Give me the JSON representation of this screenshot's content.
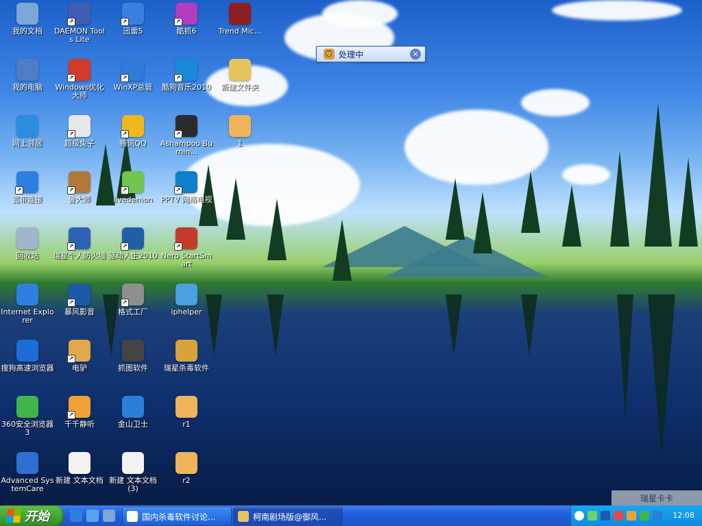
{
  "desktop": {
    "icons": [
      {
        "label": "我的文档",
        "color": "#7aa6d9"
      },
      {
        "label": "DAEMON Tools Lite",
        "color": "#3f5db0"
      },
      {
        "label": "迅雷5",
        "color": "#3a7fe0"
      },
      {
        "label": "酷抓6",
        "color": "#b33cc0"
      },
      {
        "label": "Trend Mic...",
        "color": "#8d1f1f"
      },
      {
        "label": "我的电脑",
        "color": "#4e7cc5"
      },
      {
        "label": "Windows优化大师",
        "color": "#d33a2a"
      },
      {
        "label": "WinXP总管",
        "color": "#2f7bd8"
      },
      {
        "label": "酷狗音乐2010",
        "color": "#1a8ad8"
      },
      {
        "label": "新建文件夹",
        "color": "#e7c35b"
      },
      {
        "label": "网上邻居",
        "color": "#2c8de0"
      },
      {
        "label": "超级兔子",
        "color": "#e8e8e8"
      },
      {
        "label": "腾讯QQ",
        "color": "#f1b81a"
      },
      {
        "label": "Ashampoo Burnin...",
        "color": "#2b2b2b"
      },
      {
        "label": "1",
        "color": "#f0b25a"
      },
      {
        "label": "宽带连接",
        "color": "#2e7de0"
      },
      {
        "label": "鲁大师",
        "color": "#b2783a"
      },
      {
        "label": "livedemon",
        "color": "#72c44e"
      },
      {
        "label": "PPTV 网络电视",
        "color": "#0e7fcc"
      },
      {
        "label": "回收站",
        "color": "#9fb5c9"
      },
      {
        "label": "瑞星个人防火墙",
        "color": "#2f61b7"
      },
      {
        "label": "驱动人生2010",
        "color": "#1f5fa8"
      },
      {
        "label": "Nero StartSmart",
        "color": "#c43b2b"
      },
      {
        "label": "Internet Explorer",
        "color": "#2f7fe0"
      },
      {
        "label": "暴风影音",
        "color": "#1b5aa8"
      },
      {
        "label": "格式工厂",
        "color": "#8f8f8f"
      },
      {
        "label": "iphelper",
        "color": "#4aa0e0"
      },
      {
        "label": "搜狗高速浏览器",
        "color": "#1c6dd6"
      },
      {
        "label": "电驴",
        "color": "#e0a84a"
      },
      {
        "label": "抓图软件",
        "color": "#444444"
      },
      {
        "label": "瑞星杀毒软件",
        "color": "#d8a33a"
      },
      {
        "label": "360安全浏览器 3",
        "color": "#3fb54a"
      },
      {
        "label": "千千静听",
        "color": "#f0a133"
      },
      {
        "label": "金山卫士",
        "color": "#2b7fd8"
      },
      {
        "label": "r1",
        "color": "#f0b25a"
      },
      {
        "label": "Advanced SystemCare",
        "color": "#2f6fd0"
      },
      {
        "label": "新建 文本文档",
        "color": "#f3f3f3"
      },
      {
        "label": "新建 文本文档 (3)",
        "color": "#f3f3f3"
      },
      {
        "label": "r2",
        "color": "#f0b25a"
      }
    ]
  },
  "popup": {
    "title": "处理中",
    "icon": "shield-icon",
    "close": "×"
  },
  "watermark": {
    "text": "瑞星卡卡"
  },
  "taskbar": {
    "start_label": "开始",
    "tasks": [
      {
        "label": "国内杀毒软件讨论...",
        "icon": "forum-icon"
      },
      {
        "label": "柯南剧场版@御风...",
        "icon": "folder-icon"
      }
    ],
    "clock": "12:08"
  }
}
